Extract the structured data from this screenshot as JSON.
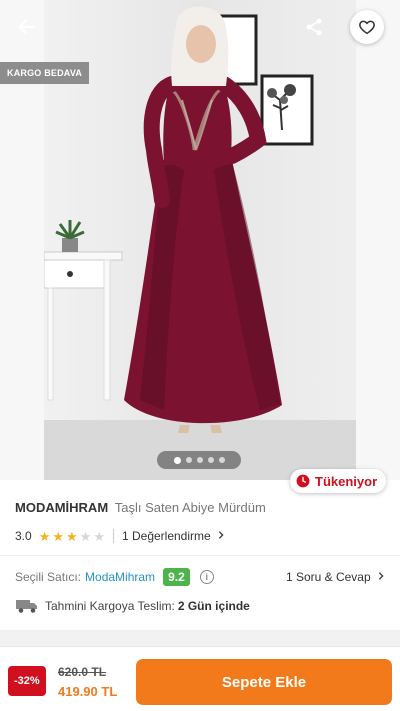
{
  "header": {
    "back_icon": "arrow-left-icon",
    "share_icon": "share-icon",
    "favorite_icon": "heart-icon"
  },
  "gallery": {
    "cargo_badge": "KARGO BEDAVA",
    "image_count": 5,
    "active_index": 1,
    "stock_badge": "Tükeniyor",
    "stock_icon": "clock-icon"
  },
  "product": {
    "brand": "MODAMİHRAM",
    "name": "Taşlı Saten Abiye Mürdüm",
    "rating": "3.0",
    "stars_filled": 3,
    "stars_total": 5,
    "reviews_link": "1 Değerlendirme"
  },
  "seller": {
    "label": "Seçili Satıcı:",
    "name": "ModaMihram",
    "score": "9.2",
    "qa_link": "1 Soru & Cevap"
  },
  "delivery": {
    "label": "Tahmini Kargoya Teslim:",
    "value": "2 Gün içinde"
  },
  "bottom_bar": {
    "discount": "-32%",
    "old_price": "620.0 TL",
    "new_price": "419.90 TL",
    "add_to_cart": "Sepete Ekle"
  },
  "colors": {
    "brand_orange": "#f27a1a",
    "danger_red": "#d0101e",
    "seller_blue": "#2591c5",
    "score_green": "#4db34b",
    "star_yellow": "#f5b41d",
    "dress_burgundy": "#7a1230"
  }
}
